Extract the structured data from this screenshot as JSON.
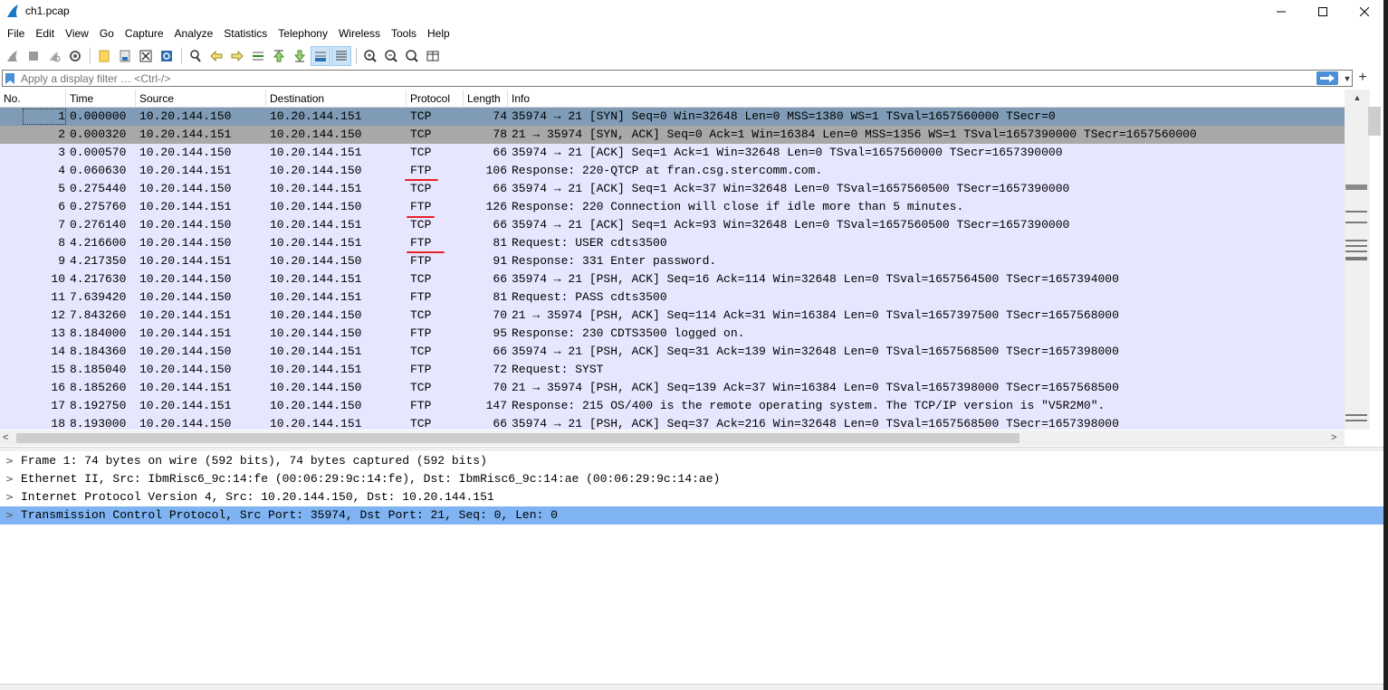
{
  "window": {
    "title": "ch1.pcap"
  },
  "menu": [
    "File",
    "Edit",
    "View",
    "Go",
    "Capture",
    "Analyze",
    "Statistics",
    "Telephony",
    "Wireless",
    "Tools",
    "Help"
  ],
  "filter": {
    "placeholder": "Apply a display filter … <Ctrl-/>"
  },
  "columns": [
    "No.",
    "Time",
    "Source",
    "Destination",
    "Protocol",
    "Length",
    "Info"
  ],
  "colors": {
    "row_bg": "#e7e6ff",
    "selected_row": "#7f9bb6",
    "marked_row": "#a8a8a8",
    "detail_selected": "#7fb3f2",
    "annotation": "#e8202a"
  },
  "packets": [
    {
      "no": "1",
      "time": "0.000000",
      "source": "10.20.144.150",
      "destination": "10.20.144.151",
      "protocol": "TCP",
      "length": "74",
      "info": "35974 → 21 [SYN] Seq=0 Win=32648 Len=0 MSS=1380 WS=1 TSval=1657560000 TSecr=0"
    },
    {
      "no": "2",
      "time": "0.000320",
      "source": "10.20.144.151",
      "destination": "10.20.144.150",
      "protocol": "TCP",
      "length": "78",
      "info": "21 → 35974 [SYN, ACK] Seq=0 Ack=1 Win=16384 Len=0 MSS=1356 WS=1 TSval=1657390000 TSecr=1657560000"
    },
    {
      "no": "3",
      "time": "0.000570",
      "source": "10.20.144.150",
      "destination": "10.20.144.151",
      "protocol": "TCP",
      "length": "66",
      "info": "35974 → 21 [ACK] Seq=1 Ack=1 Win=32648 Len=0 TSval=1657560000 TSecr=1657390000"
    },
    {
      "no": "4",
      "time": "0.060630",
      "source": "10.20.144.151",
      "destination": "10.20.144.150",
      "protocol": "FTP",
      "length": "106",
      "info": "Response: 220-QTCP at fran.csg.stercomm.com."
    },
    {
      "no": "5",
      "time": "0.275440",
      "source": "10.20.144.150",
      "destination": "10.20.144.151",
      "protocol": "TCP",
      "length": "66",
      "info": "35974 → 21 [ACK] Seq=1 Ack=37 Win=32648 Len=0 TSval=1657560500 TSecr=1657390000"
    },
    {
      "no": "6",
      "time": "0.275760",
      "source": "10.20.144.151",
      "destination": "10.20.144.150",
      "protocol": "FTP",
      "length": "126",
      "info": "Response: 220 Connection will close if idle more than 5 minutes."
    },
    {
      "no": "7",
      "time": "0.276140",
      "source": "10.20.144.150",
      "destination": "10.20.144.151",
      "protocol": "TCP",
      "length": "66",
      "info": "35974 → 21 [ACK] Seq=1 Ack=93 Win=32648 Len=0 TSval=1657560500 TSecr=1657390000"
    },
    {
      "no": "8",
      "time": "4.216600",
      "source": "10.20.144.150",
      "destination": "10.20.144.151",
      "protocol": "FTP",
      "length": "81",
      "info": "Request: USER cdts3500"
    },
    {
      "no": "9",
      "time": "4.217350",
      "source": "10.20.144.151",
      "destination": "10.20.144.150",
      "protocol": "FTP",
      "length": "91",
      "info": "Response: 331 Enter password."
    },
    {
      "no": "10",
      "time": "4.217630",
      "source": "10.20.144.150",
      "destination": "10.20.144.151",
      "protocol": "TCP",
      "length": "66",
      "info": "35974 → 21 [PSH, ACK] Seq=16 Ack=114 Win=32648 Len=0 TSval=1657564500 TSecr=1657394000"
    },
    {
      "no": "11",
      "time": "7.639420",
      "source": "10.20.144.150",
      "destination": "10.20.144.151",
      "protocol": "FTP",
      "length": "81",
      "info": "Request: PASS cdts3500"
    },
    {
      "no": "12",
      "time": "7.843260",
      "source": "10.20.144.151",
      "destination": "10.20.144.150",
      "protocol": "TCP",
      "length": "70",
      "info": "21 → 35974 [PSH, ACK] Seq=114 Ack=31 Win=16384 Len=0 TSval=1657397500 TSecr=1657568000"
    },
    {
      "no": "13",
      "time": "8.184000",
      "source": "10.20.144.151",
      "destination": "10.20.144.150",
      "protocol": "FTP",
      "length": "95",
      "info": "Response: 230 CDTS3500 logged on."
    },
    {
      "no": "14",
      "time": "8.184360",
      "source": "10.20.144.150",
      "destination": "10.20.144.151",
      "protocol": "TCP",
      "length": "66",
      "info": "35974 → 21 [PSH, ACK] Seq=31 Ack=139 Win=32648 Len=0 TSval=1657568500 TSecr=1657398000"
    },
    {
      "no": "15",
      "time": "8.185040",
      "source": "10.20.144.150",
      "destination": "10.20.144.151",
      "protocol": "FTP",
      "length": "72",
      "info": "Request: SYST"
    },
    {
      "no": "16",
      "time": "8.185260",
      "source": "10.20.144.151",
      "destination": "10.20.144.150",
      "protocol": "TCP",
      "length": "70",
      "info": "21 → 35974 [PSH, ACK] Seq=139 Ack=37 Win=16384 Len=0 TSval=1657398000 TSecr=1657568500"
    },
    {
      "no": "17",
      "time": "8.192750",
      "source": "10.20.144.151",
      "destination": "10.20.144.150",
      "protocol": "FTP",
      "length": "147",
      "info": "Response: 215  OS/400 is the remote operating system. The TCP/IP version is \"V5R2M0\"."
    },
    {
      "no": "18",
      "time": "8.193000",
      "source": "10.20.144.150",
      "destination": "10.20.144.151",
      "protocol": "TCP",
      "length": "66",
      "info": "35974 → 21 [PSH, ACK] Seq=37 Ack=216 Win=32648 Len=0 TSval=1657568500 TSecr=1657398000"
    }
  ],
  "details": [
    "Frame 1: 74 bytes on wire (592 bits), 74 bytes captured (592 bits)",
    "Ethernet II, Src: IbmRisc6_9c:14:fe (00:06:29:9c:14:fe), Dst: IbmRisc6_9c:14:ae (00:06:29:9c:14:ae)",
    "Internet Protocol Version 4, Src: 10.20.144.150, Dst: 10.20.144.151",
    "Transmission Control Protocol, Src Port: 35974, Dst Port: 21, Seq: 0, Len: 0"
  ]
}
